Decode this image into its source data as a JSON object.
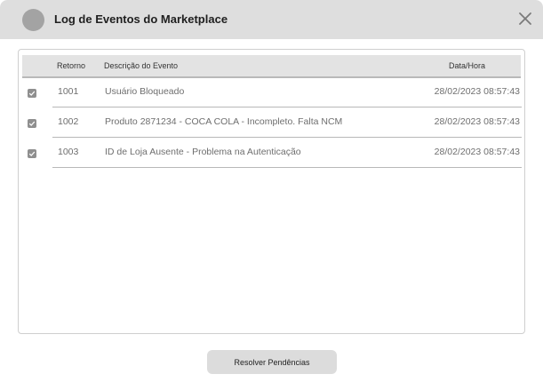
{
  "dialog": {
    "title": "Log de Eventos do Marketplace",
    "close_icon": "close-icon",
    "avatar_icon": "app-avatar"
  },
  "table": {
    "columns": {
      "ret": "Retorno",
      "desc": "Descrição do Evento",
      "date": "Data/Hora"
    },
    "rows": [
      {
        "checked": true,
        "ret": "1001",
        "desc": "Usuário Bloqueado",
        "date": "28/02/2023 08:57:43"
      },
      {
        "checked": true,
        "ret": "1002",
        "desc": "Produto 2871234 - COCA COLA - Incompleto. Falta NCM",
        "date": "28/02/2023 08:57:43"
      },
      {
        "checked": true,
        "ret": "1003",
        "desc": "ID de Loja Ausente - Problema na Autenticação",
        "date": "28/02/2023 08:57:43"
      }
    ]
  },
  "footer": {
    "resolve_label": "Resolver Pendências"
  },
  "colors": {
    "titlebar": "#dedede",
    "checkbox": "#8f8f8f",
    "button": "#dcdcdc"
  }
}
